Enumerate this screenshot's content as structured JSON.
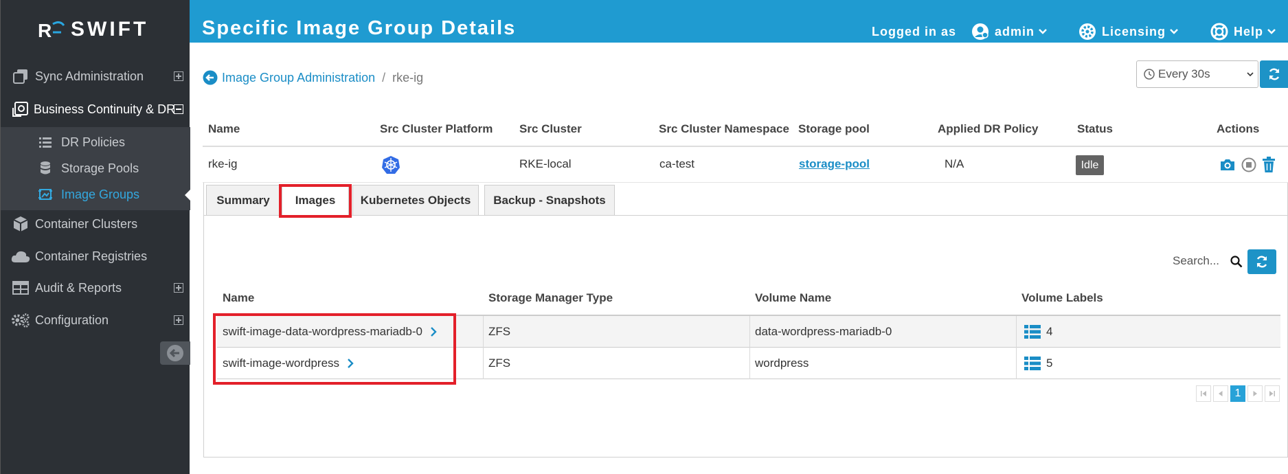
{
  "brand": {
    "name": "SWIFT",
    "accent": "#1f9bd1"
  },
  "header": {
    "title": "Specific Image Group Details",
    "logged_in_label": "Logged in as",
    "user": "admin",
    "licensing": "Licensing",
    "help": "Help"
  },
  "sidebar": {
    "items": [
      {
        "label": "Sync Administration",
        "icon": "copy-icon"
      },
      {
        "label": "Business Continuity & DR",
        "icon": "dr-settings-icon"
      },
      {
        "label": "Container Clusters",
        "icon": "cube-icon"
      },
      {
        "label": "Container Registries",
        "icon": "cloud-icon"
      },
      {
        "label": "Audit & Reports",
        "icon": "table-icon"
      },
      {
        "label": "Configuration",
        "icon": "gears-icon"
      }
    ],
    "subitems": [
      {
        "label": "DR Policies",
        "icon": "list-icon"
      },
      {
        "label": "Storage Pools",
        "icon": "database-icon"
      },
      {
        "label": "Image Groups",
        "icon": "image-group-icon"
      }
    ]
  },
  "breadcrumb": {
    "parent": "Image Group Administration",
    "separator": "/",
    "current": "rke-ig"
  },
  "refresh": {
    "interval": "Every 30s"
  },
  "summary": {
    "headers": {
      "name": "Name",
      "platform": "Src Cluster Platform",
      "cluster": "Src Cluster",
      "namespace": "Src Cluster Namespace",
      "pool": "Storage pool",
      "policy": "Applied DR Policy",
      "status": "Status",
      "actions": "Actions"
    },
    "row": {
      "name": "rke-ig",
      "platform_icon": "kubernetes-icon",
      "cluster": "RKE-local",
      "namespace": "ca-test",
      "pool": "storage-pool",
      "policy": "N/A",
      "status": "Idle"
    }
  },
  "tabs": {
    "summary": "Summary",
    "images": "Images",
    "k8s": "Kubernetes Objects",
    "backup": "Backup - Snapshots"
  },
  "search": {
    "placeholder": "Search..."
  },
  "images_table": {
    "headers": {
      "name": "Name",
      "type": "Storage Manager Type",
      "volume": "Volume Name",
      "labels": "Volume Labels"
    },
    "rows": [
      {
        "name": "swift-image-data-wordpress-mariadb-0",
        "type": "ZFS",
        "volume": "data-wordpress-mariadb-0",
        "labels": "4"
      },
      {
        "name": "swift-image-wordpress",
        "type": "ZFS",
        "volume": "wordpress",
        "labels": "5"
      }
    ]
  },
  "pager": {
    "current": "1"
  }
}
